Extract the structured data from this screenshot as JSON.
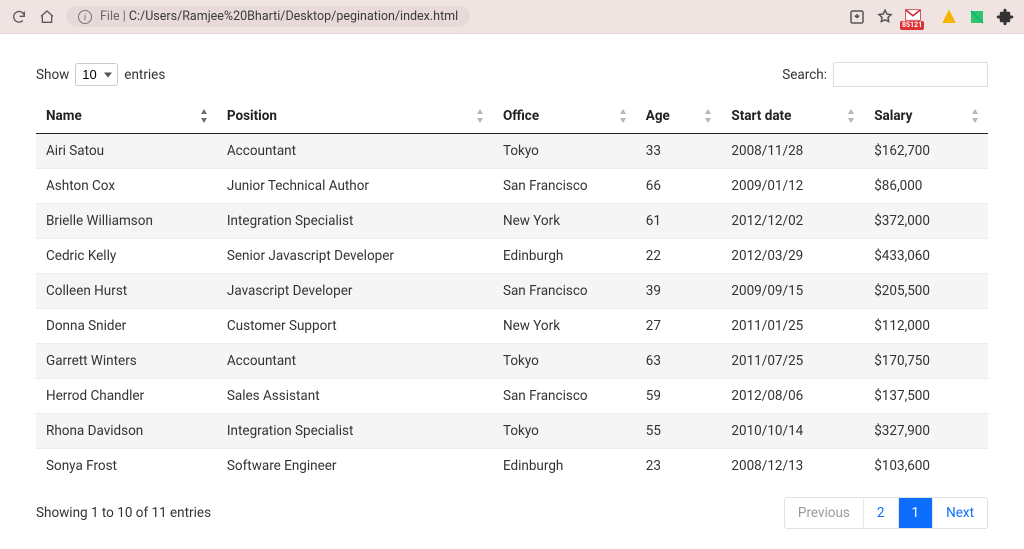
{
  "browser": {
    "url_prefix": "File  |  ",
    "url": "C:/Users/Ramjee%20Bharti/Desktop/pegination/index.html",
    "gmail_badge": "85121"
  },
  "controls": {
    "show_label": "Show",
    "entries_label": "entries",
    "length_value": "10",
    "search_label": "Search:",
    "search_value": ""
  },
  "columns": [
    "Name",
    "Position",
    "Office",
    "Age",
    "Start date",
    "Salary"
  ],
  "rows": [
    {
      "name": "Airi Satou",
      "position": "Accountant",
      "office": "Tokyo",
      "age": "33",
      "start": "2008/11/28",
      "salary": "$162,700"
    },
    {
      "name": "Ashton Cox",
      "position": "Junior Technical Author",
      "office": "San Francisco",
      "age": "66",
      "start": "2009/01/12",
      "salary": "$86,000"
    },
    {
      "name": "Brielle Williamson",
      "position": "Integration Specialist",
      "office": "New York",
      "age": "61",
      "start": "2012/12/02",
      "salary": "$372,000"
    },
    {
      "name": "Cedric Kelly",
      "position": "Senior Javascript Developer",
      "office": "Edinburgh",
      "age": "22",
      "start": "2012/03/29",
      "salary": "$433,060"
    },
    {
      "name": "Colleen Hurst",
      "position": "Javascript Developer",
      "office": "San Francisco",
      "age": "39",
      "start": "2009/09/15",
      "salary": "$205,500"
    },
    {
      "name": "Donna Snider",
      "position": "Customer Support",
      "office": "New York",
      "age": "27",
      "start": "2011/01/25",
      "salary": "$112,000"
    },
    {
      "name": "Garrett Winters",
      "position": "Accountant",
      "office": "Tokyo",
      "age": "63",
      "start": "2011/07/25",
      "salary": "$170,750"
    },
    {
      "name": "Herrod Chandler",
      "position": "Sales Assistant",
      "office": "San Francisco",
      "age": "59",
      "start": "2012/08/06",
      "salary": "$137,500"
    },
    {
      "name": "Rhona Davidson",
      "position": "Integration Specialist",
      "office": "Tokyo",
      "age": "55",
      "start": "2010/10/14",
      "salary": "$327,900"
    },
    {
      "name": "Sonya Frost",
      "position": "Software Engineer",
      "office": "Edinburgh",
      "age": "23",
      "start": "2008/12/13",
      "salary": "$103,600"
    }
  ],
  "info_text": "Showing 1 to 10 of 11 entries",
  "pager": {
    "previous": "Previous",
    "next": "Next",
    "pages": [
      "1",
      "2"
    ],
    "active_index": 0
  }
}
